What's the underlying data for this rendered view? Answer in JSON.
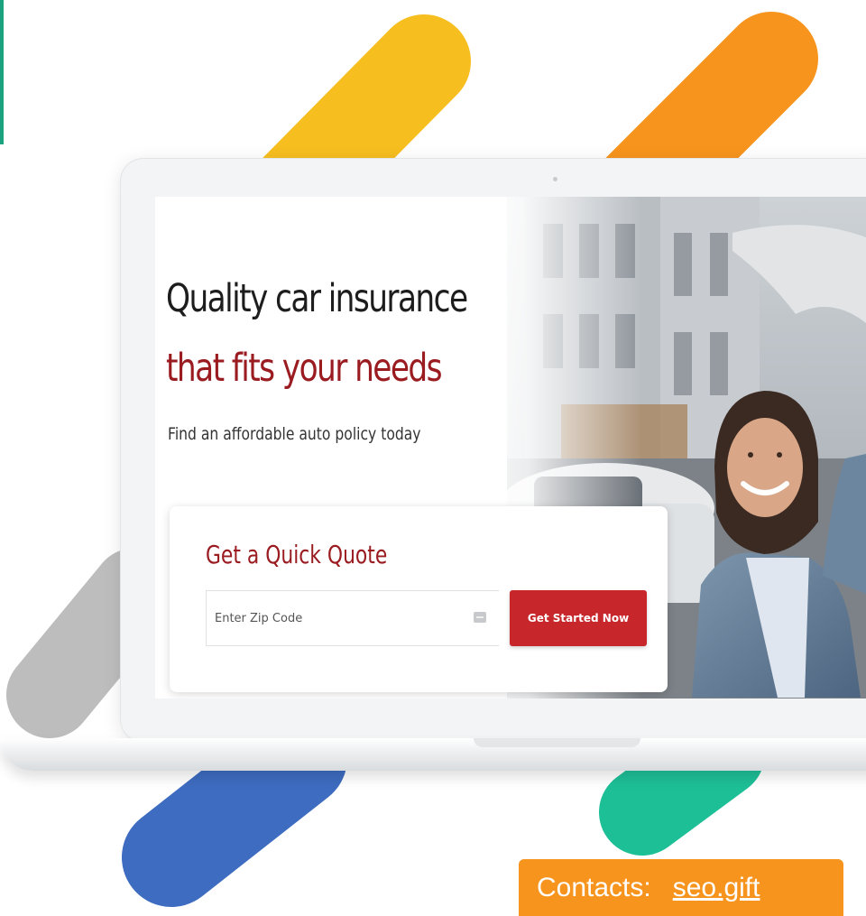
{
  "colors": {
    "accent_yellow": "#f6be1f",
    "accent_orange": "#f7941d",
    "accent_blue": "#3e6cc0",
    "accent_green": "#1dbf97",
    "accent_gray": "#bdbdbd",
    "brand_red": "#9a1b20",
    "button_red": "#c7262b"
  },
  "hero": {
    "headline_line1": "Quality car insurance",
    "headline_line2": "that fits your needs",
    "subheadline": "Find an affordable auto policy today"
  },
  "quote_form": {
    "title": "Get a Quick Quote",
    "zip_placeholder": "Enter Zip Code",
    "zip_icon": "keyboard-icon",
    "cta_label": "Get Started Now"
  },
  "contact": {
    "label": "Contacts:",
    "link_text": "seo.gift"
  }
}
